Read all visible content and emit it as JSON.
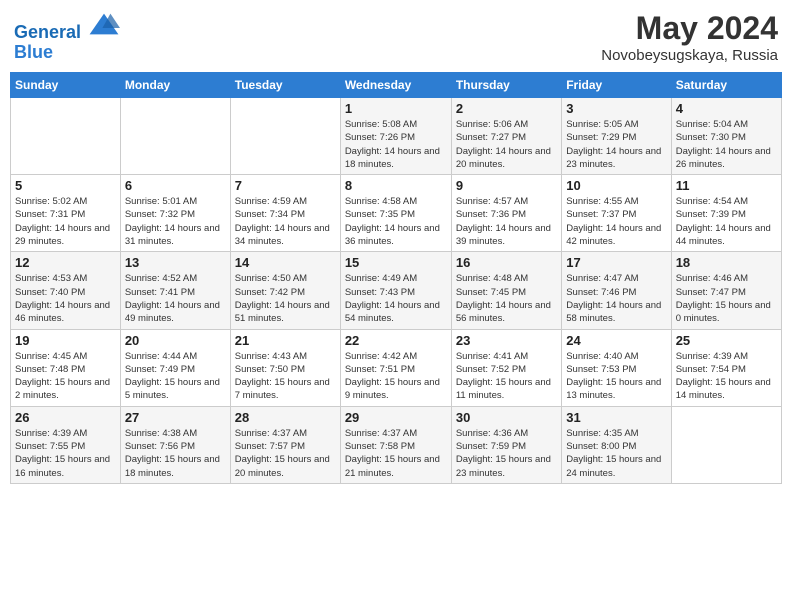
{
  "logo": {
    "line1": "General",
    "line2": "Blue"
  },
  "title": "May 2024",
  "location": "Novobeysugskaya, Russia",
  "weekdays": [
    "Sunday",
    "Monday",
    "Tuesday",
    "Wednesday",
    "Thursday",
    "Friday",
    "Saturday"
  ],
  "weeks": [
    [
      {
        "num": "",
        "sunrise": "",
        "sunset": "",
        "daylight": ""
      },
      {
        "num": "",
        "sunrise": "",
        "sunset": "",
        "daylight": ""
      },
      {
        "num": "",
        "sunrise": "",
        "sunset": "",
        "daylight": ""
      },
      {
        "num": "1",
        "sunrise": "Sunrise: 5:08 AM",
        "sunset": "Sunset: 7:26 PM",
        "daylight": "Daylight: 14 hours and 18 minutes."
      },
      {
        "num": "2",
        "sunrise": "Sunrise: 5:06 AM",
        "sunset": "Sunset: 7:27 PM",
        "daylight": "Daylight: 14 hours and 20 minutes."
      },
      {
        "num": "3",
        "sunrise": "Sunrise: 5:05 AM",
        "sunset": "Sunset: 7:29 PM",
        "daylight": "Daylight: 14 hours and 23 minutes."
      },
      {
        "num": "4",
        "sunrise": "Sunrise: 5:04 AM",
        "sunset": "Sunset: 7:30 PM",
        "daylight": "Daylight: 14 hours and 26 minutes."
      }
    ],
    [
      {
        "num": "5",
        "sunrise": "Sunrise: 5:02 AM",
        "sunset": "Sunset: 7:31 PM",
        "daylight": "Daylight: 14 hours and 29 minutes."
      },
      {
        "num": "6",
        "sunrise": "Sunrise: 5:01 AM",
        "sunset": "Sunset: 7:32 PM",
        "daylight": "Daylight: 14 hours and 31 minutes."
      },
      {
        "num": "7",
        "sunrise": "Sunrise: 4:59 AM",
        "sunset": "Sunset: 7:34 PM",
        "daylight": "Daylight: 14 hours and 34 minutes."
      },
      {
        "num": "8",
        "sunrise": "Sunrise: 4:58 AM",
        "sunset": "Sunset: 7:35 PM",
        "daylight": "Daylight: 14 hours and 36 minutes."
      },
      {
        "num": "9",
        "sunrise": "Sunrise: 4:57 AM",
        "sunset": "Sunset: 7:36 PM",
        "daylight": "Daylight: 14 hours and 39 minutes."
      },
      {
        "num": "10",
        "sunrise": "Sunrise: 4:55 AM",
        "sunset": "Sunset: 7:37 PM",
        "daylight": "Daylight: 14 hours and 42 minutes."
      },
      {
        "num": "11",
        "sunrise": "Sunrise: 4:54 AM",
        "sunset": "Sunset: 7:39 PM",
        "daylight": "Daylight: 14 hours and 44 minutes."
      }
    ],
    [
      {
        "num": "12",
        "sunrise": "Sunrise: 4:53 AM",
        "sunset": "Sunset: 7:40 PM",
        "daylight": "Daylight: 14 hours and 46 minutes."
      },
      {
        "num": "13",
        "sunrise": "Sunrise: 4:52 AM",
        "sunset": "Sunset: 7:41 PM",
        "daylight": "Daylight: 14 hours and 49 minutes."
      },
      {
        "num": "14",
        "sunrise": "Sunrise: 4:50 AM",
        "sunset": "Sunset: 7:42 PM",
        "daylight": "Daylight: 14 hours and 51 minutes."
      },
      {
        "num": "15",
        "sunrise": "Sunrise: 4:49 AM",
        "sunset": "Sunset: 7:43 PM",
        "daylight": "Daylight: 14 hours and 54 minutes."
      },
      {
        "num": "16",
        "sunrise": "Sunrise: 4:48 AM",
        "sunset": "Sunset: 7:45 PM",
        "daylight": "Daylight: 14 hours and 56 minutes."
      },
      {
        "num": "17",
        "sunrise": "Sunrise: 4:47 AM",
        "sunset": "Sunset: 7:46 PM",
        "daylight": "Daylight: 14 hours and 58 minutes."
      },
      {
        "num": "18",
        "sunrise": "Sunrise: 4:46 AM",
        "sunset": "Sunset: 7:47 PM",
        "daylight": "Daylight: 15 hours and 0 minutes."
      }
    ],
    [
      {
        "num": "19",
        "sunrise": "Sunrise: 4:45 AM",
        "sunset": "Sunset: 7:48 PM",
        "daylight": "Daylight: 15 hours and 2 minutes."
      },
      {
        "num": "20",
        "sunrise": "Sunrise: 4:44 AM",
        "sunset": "Sunset: 7:49 PM",
        "daylight": "Daylight: 15 hours and 5 minutes."
      },
      {
        "num": "21",
        "sunrise": "Sunrise: 4:43 AM",
        "sunset": "Sunset: 7:50 PM",
        "daylight": "Daylight: 15 hours and 7 minutes."
      },
      {
        "num": "22",
        "sunrise": "Sunrise: 4:42 AM",
        "sunset": "Sunset: 7:51 PM",
        "daylight": "Daylight: 15 hours and 9 minutes."
      },
      {
        "num": "23",
        "sunrise": "Sunrise: 4:41 AM",
        "sunset": "Sunset: 7:52 PM",
        "daylight": "Daylight: 15 hours and 11 minutes."
      },
      {
        "num": "24",
        "sunrise": "Sunrise: 4:40 AM",
        "sunset": "Sunset: 7:53 PM",
        "daylight": "Daylight: 15 hours and 13 minutes."
      },
      {
        "num": "25",
        "sunrise": "Sunrise: 4:39 AM",
        "sunset": "Sunset: 7:54 PM",
        "daylight": "Daylight: 15 hours and 14 minutes."
      }
    ],
    [
      {
        "num": "26",
        "sunrise": "Sunrise: 4:39 AM",
        "sunset": "Sunset: 7:55 PM",
        "daylight": "Daylight: 15 hours and 16 minutes."
      },
      {
        "num": "27",
        "sunrise": "Sunrise: 4:38 AM",
        "sunset": "Sunset: 7:56 PM",
        "daylight": "Daylight: 15 hours and 18 minutes."
      },
      {
        "num": "28",
        "sunrise": "Sunrise: 4:37 AM",
        "sunset": "Sunset: 7:57 PM",
        "daylight": "Daylight: 15 hours and 20 minutes."
      },
      {
        "num": "29",
        "sunrise": "Sunrise: 4:37 AM",
        "sunset": "Sunset: 7:58 PM",
        "daylight": "Daylight: 15 hours and 21 minutes."
      },
      {
        "num": "30",
        "sunrise": "Sunrise: 4:36 AM",
        "sunset": "Sunset: 7:59 PM",
        "daylight": "Daylight: 15 hours and 23 minutes."
      },
      {
        "num": "31",
        "sunrise": "Sunrise: 4:35 AM",
        "sunset": "Sunset: 8:00 PM",
        "daylight": "Daylight: 15 hours and 24 minutes."
      },
      {
        "num": "",
        "sunrise": "",
        "sunset": "",
        "daylight": ""
      }
    ]
  ]
}
